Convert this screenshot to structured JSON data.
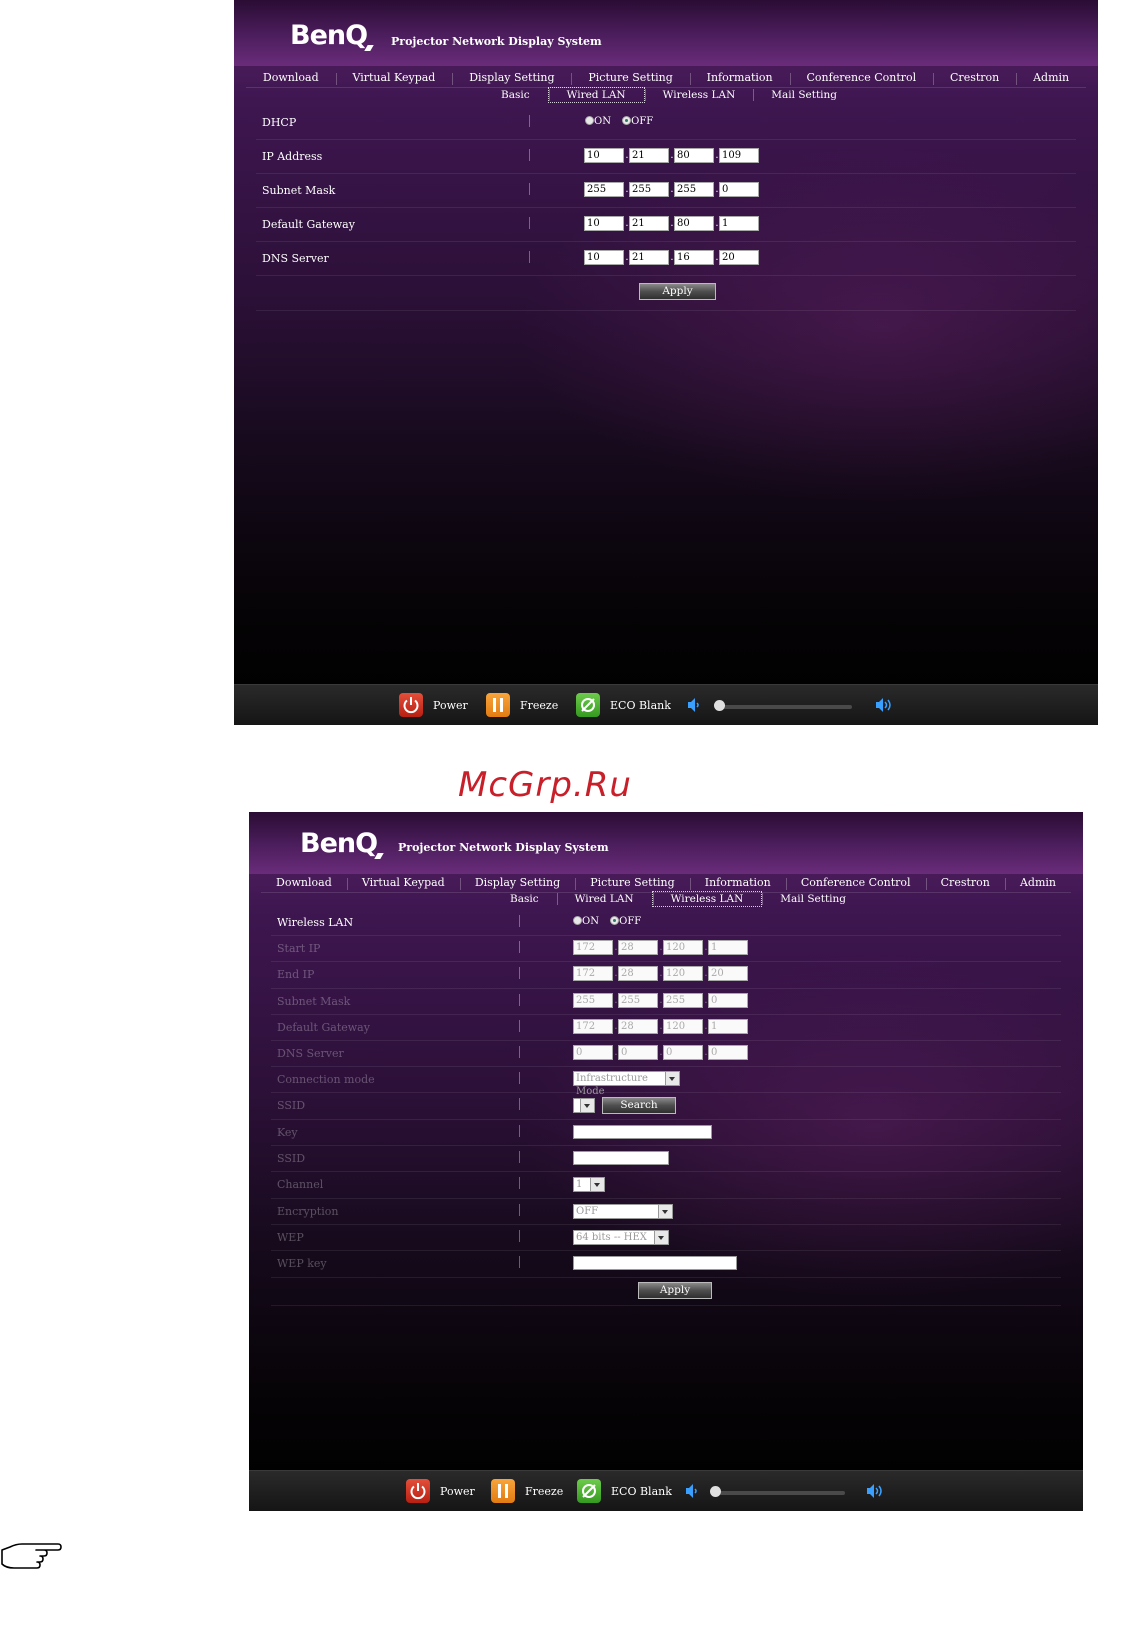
{
  "watermark": "McGrp.Ru",
  "app": {
    "logo": "BenQ",
    "title": "Projector Network Display System",
    "menu": [
      "Download",
      "Virtual Keypad",
      "Display Setting",
      "Picture Setting",
      "Information",
      "Conference Control",
      "Crestron",
      "Admin"
    ],
    "submenu": [
      "Basic",
      "Wired LAN",
      "Wireless LAN",
      "Mail Setting"
    ]
  },
  "wired": {
    "active_tab": "Wired LAN",
    "dhcp": {
      "label": "DHCP",
      "on": "ON",
      "off": "OFF",
      "selected": "OFF"
    },
    "ip": {
      "label": "IP Address",
      "values": [
        "10",
        "21",
        "80",
        "109"
      ]
    },
    "mask": {
      "label": "Subnet Mask",
      "values": [
        "255",
        "255",
        "255",
        "0"
      ]
    },
    "gateway": {
      "label": "Default Gateway",
      "values": [
        "10",
        "21",
        "80",
        "1"
      ]
    },
    "dns": {
      "label": "DNS Server",
      "values": [
        "10",
        "21",
        "16",
        "20"
      ]
    },
    "apply": "Apply"
  },
  "wireless": {
    "active_tab": "Wireless LAN",
    "wlan": {
      "label": "Wireless LAN",
      "on": "ON",
      "off": "OFF",
      "selected": "OFF"
    },
    "start_ip": {
      "label": "Start IP",
      "values": [
        "172",
        "28",
        "120",
        "1"
      ]
    },
    "end_ip": {
      "label": "End IP",
      "values": [
        "172",
        "28",
        "120",
        "20"
      ]
    },
    "mask": {
      "label": "Subnet Mask",
      "values": [
        "255",
        "255",
        "255",
        "0"
      ]
    },
    "gateway": {
      "label": "Default Gateway",
      "values": [
        "172",
        "28",
        "120",
        "1"
      ]
    },
    "dns": {
      "label": "DNS Server",
      "values": [
        "0",
        "0",
        "0",
        "0"
      ]
    },
    "conn_mode": {
      "label": "Connection mode",
      "value": "Infrastructure Mode"
    },
    "ssid_search": {
      "label": "SSID",
      "value": "",
      "button": "Search"
    },
    "key": {
      "label": "Key",
      "value": ""
    },
    "ssid": {
      "label": "SSID",
      "value": ""
    },
    "channel": {
      "label": "Channel",
      "value": "1"
    },
    "encryption": {
      "label": "Encryption",
      "value": "OFF"
    },
    "wep": {
      "label": "WEP",
      "value": "64 bits -- HEX"
    },
    "wep_key": {
      "label": "WEP key",
      "value": ""
    },
    "apply": "Apply"
  },
  "footer": {
    "power": "Power",
    "freeze": "Freeze",
    "eco": "ECO Blank",
    "volume_level": 0
  }
}
